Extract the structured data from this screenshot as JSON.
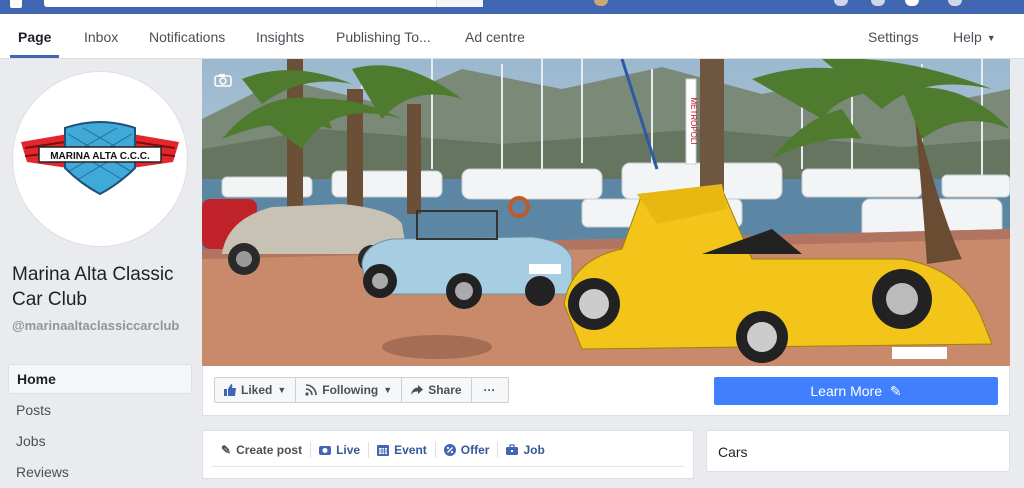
{
  "tabs": [
    {
      "label": "Page"
    },
    {
      "label": "Inbox"
    },
    {
      "label": "Notifications"
    },
    {
      "label": "Insights"
    },
    {
      "label": "Publishing To..."
    },
    {
      "label": "Ad centre"
    },
    {
      "label": "Settings"
    },
    {
      "label": "Help"
    }
  ],
  "profile": {
    "logo_text": "MARINA ALTA C.C.C.",
    "name": "Marina Alta Classic Car Club",
    "handle": "@marinaaltaclassiccarclub"
  },
  "left_nav": [
    {
      "label": "Home"
    },
    {
      "label": "Posts"
    },
    {
      "label": "Jobs"
    },
    {
      "label": "Reviews"
    }
  ],
  "actions": {
    "liked": "Liked",
    "following": "Following",
    "share": "Share",
    "more": "···",
    "learn_more": "Learn More"
  },
  "composer": {
    "create_post": "Create post",
    "live": "Live",
    "event": "Event",
    "offer": "Offer",
    "job": "Job"
  },
  "sidebar_card": {
    "title": "Cars"
  },
  "cover_sign": "METROPOLI",
  "colors": {
    "brand": "#4267b2",
    "button_blue": "#4080ff",
    "link_blue": "#365899"
  }
}
